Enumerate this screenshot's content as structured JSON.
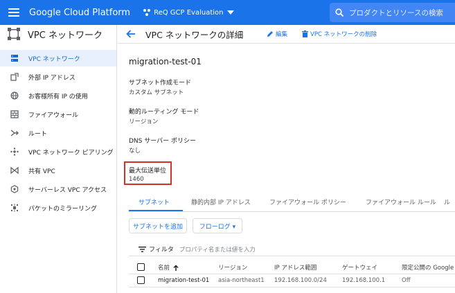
{
  "topbar": {
    "brand": "Google Cloud Platform",
    "project": "ReQ GCP Evaluation",
    "search_placeholder": "プロダクトとリソースの検索"
  },
  "sidebar": {
    "title": "VPC ネットワーク",
    "items": [
      {
        "label": "VPC ネットワーク",
        "icon": "vpc-network-icon",
        "active": true
      },
      {
        "label": "外部 IP アドレス",
        "icon": "external-ip-icon"
      },
      {
        "label": "お客様所有 IP の使用",
        "icon": "byoip-icon"
      },
      {
        "label": "ファイアウォール",
        "icon": "firewall-icon"
      },
      {
        "label": "ルート",
        "icon": "route-icon"
      },
      {
        "label": "VPC ネットワーク ピアリング",
        "icon": "peering-icon"
      },
      {
        "label": "共有 VPC",
        "icon": "shared-vpc-icon"
      },
      {
        "label": "サーバーレス VPC アクセス",
        "icon": "serverless-icon"
      },
      {
        "label": "パケットのミラーリング",
        "icon": "packet-mirroring-icon"
      }
    ]
  },
  "header": {
    "title": "VPC ネットワークの詳細",
    "edit": "編集",
    "delete": "VPC ネットワークの削除"
  },
  "details": {
    "name": "migration-test-01",
    "props": [
      {
        "label": "サブネット作成モード",
        "value": "カスタム サブネット"
      },
      {
        "label": "動的ルーティング モード",
        "value": "リージョン"
      },
      {
        "label": "DNS サーバー ポリシー",
        "value": "なし"
      },
      {
        "label": "最大伝送単位",
        "value": "1460"
      }
    ]
  },
  "tabs": [
    "サブネット",
    "静的内部 IP アドレス",
    "ファイアウォール ポリシー",
    "ファイアウォール ルール",
    "ル"
  ],
  "buttons": {
    "add_subnet": "サブネットを追加",
    "flow_logs": "フローログ ▾"
  },
  "filter": {
    "label": "フィルタ",
    "placeholder": "プロパティ名または値を入力"
  },
  "table": {
    "headers": [
      "名前",
      "リージョン",
      "IP アドレス範囲",
      "ゲートウェイ",
      "限定公開の Google ア"
    ],
    "rows": [
      [
        "migration-test-01",
        "asia-northeast1",
        "192.168.100.0/24",
        "192.168.100.1",
        "Off"
      ]
    ]
  },
  "colors": {
    "accent": "#1a73e8",
    "highlight_box": "#d93025"
  }
}
